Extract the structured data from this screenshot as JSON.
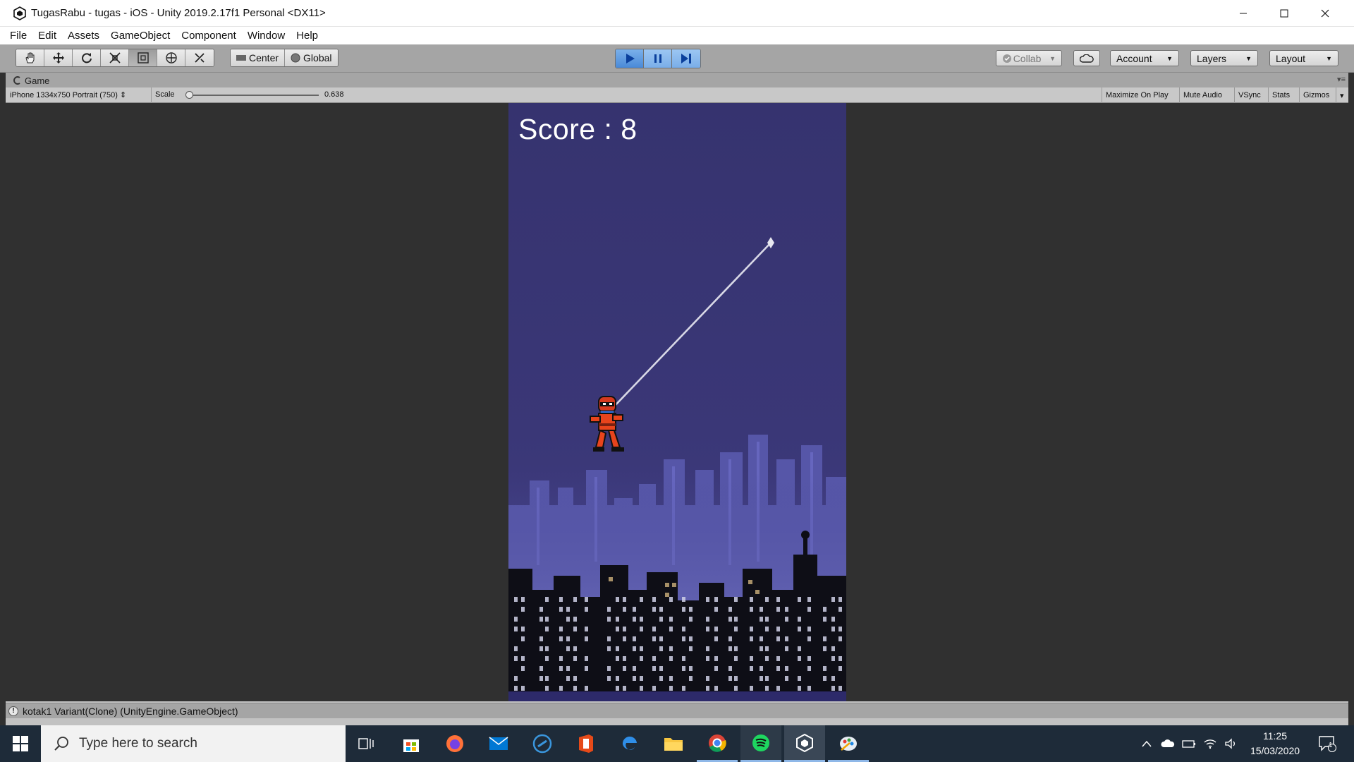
{
  "window": {
    "title": "TugasRabu - tugas - iOS - Unity 2019.2.17f1 Personal <DX11>"
  },
  "menu": [
    "File",
    "Edit",
    "Assets",
    "GameObject",
    "Component",
    "Window",
    "Help"
  ],
  "toolbar": {
    "tools": [
      "hand-tool-icon",
      "move-tool-icon",
      "rotate-tool-icon",
      "scale-tool-icon",
      "rect-tool-icon",
      "transform-tool-icon",
      "custom-tool-icon"
    ],
    "active_tool_index": 4,
    "pivot_label": "Center",
    "space_label": "Global",
    "play_state": "playing",
    "collab_label": "Collab",
    "account_label": "Account",
    "layers_label": "Layers",
    "layout_label": "Layout"
  },
  "game_view": {
    "tab_label": "Game",
    "resolution": "iPhone 1334x750 Portrait (750)",
    "scale_label": "Scale",
    "scale_value": "0.638",
    "scale_fraction": 0.0,
    "buttons": [
      "Maximize On Play",
      "Mute Audio",
      "VSync",
      "Stats",
      "Gizmos"
    ]
  },
  "game": {
    "score_text": "Score : 8"
  },
  "status": {
    "message": "kotak1 Variant(Clone) (UnityEngine.GameObject)"
  },
  "taskbar": {
    "search_placeholder": "Type here to search",
    "apps": [
      "task-view-icon",
      "store-icon",
      "firefox-icon",
      "mail-icon",
      "app-icon",
      "office-icon",
      "edge-icon",
      "file-explorer-icon",
      "chrome-icon",
      "spotify-icon",
      "unity-icon",
      "paint-icon"
    ],
    "time": "11:25",
    "date": "15/03/2020",
    "notification_count": "1"
  },
  "colors": {
    "game_sky": "#36336f",
    "play_active": "#4a8ad8",
    "editor_toolbar": "#a5a5a5",
    "taskbar": "#1e2b39"
  }
}
